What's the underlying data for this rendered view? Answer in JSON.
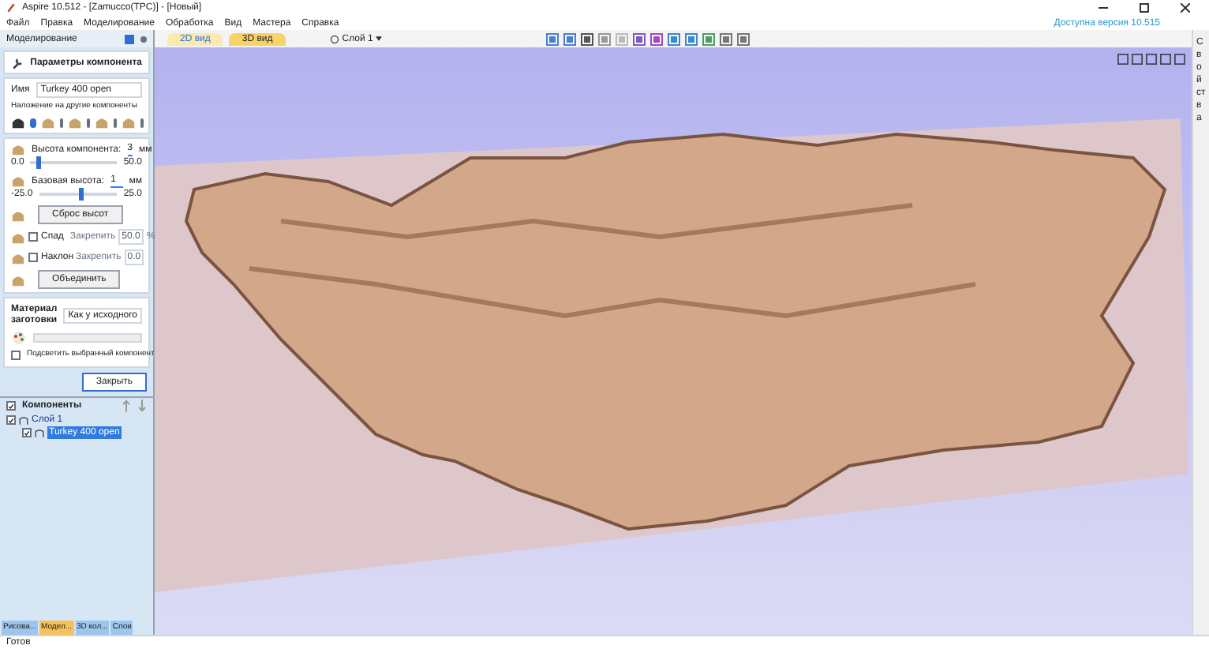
{
  "window": {
    "title": "Aspire 10.512 - [Zamucco(TPC)] - [Новый]",
    "update_link": "Доступна версия 10.515"
  },
  "menu": [
    "Файл",
    "Правка",
    "Моделирование",
    "Обработка",
    "Вид",
    "Мастера",
    "Справка"
  ],
  "view_tabs": [
    {
      "label": "2D вид",
      "selected": false
    },
    {
      "label": "3D вид",
      "selected": true
    }
  ],
  "layer_dropdown": "Слой 1",
  "panel": {
    "title": "Моделирование",
    "header": "Параметры компонента",
    "name_label": "Имя",
    "name_value": "Turkey 400 open",
    "overlay_label": "Наложение на другие компоненты",
    "overlay_modes": [
      {
        "selected": true
      },
      {
        "selected": false
      },
      {
        "selected": false
      },
      {
        "selected": false
      },
      {
        "selected": false
      }
    ],
    "height": {
      "label": "Высота компонента:",
      "value": "3",
      "unit": "мм",
      "min": "0.0",
      "max": "50.0",
      "level": 0.06
    },
    "base": {
      "label": "Базовая высота:",
      "value": "1",
      "unit": "мм",
      "min": "-25.0",
      "max": "25.0",
      "level": 0.52
    },
    "reset_button": "Сброс высот",
    "fade": {
      "label": "Спад",
      "checked": false,
      "lock": "Закрепить",
      "value": "50.0",
      "unit": "%"
    },
    "tilt": {
      "label": "Наклон",
      "checked": false,
      "lock": "Закрепить",
      "value": "0.0"
    },
    "merge_button": "Объединить",
    "material": {
      "label": "Материал заготовки",
      "value": "Как у исходного"
    },
    "highlight": {
      "label": "Подсветить выбранный компонент",
      "checked": false
    },
    "close_button": "Закрыть"
  },
  "components": {
    "title": "Компоненты",
    "checked": true,
    "tree": [
      {
        "label": "Слой 1",
        "checked": true,
        "children": [
          {
            "label": "Turkey 400 open",
            "checked": true,
            "selected": true
          }
        ]
      }
    ]
  },
  "bottom_tabs": [
    {
      "label": "Рисова...",
      "selected": false
    },
    {
      "label": "Модел...",
      "selected": true
    },
    {
      "label": "3D кол...",
      "selected": false
    },
    {
      "label": "Слои",
      "selected": false
    }
  ],
  "side_tab": "Свойства",
  "status": "Готов"
}
